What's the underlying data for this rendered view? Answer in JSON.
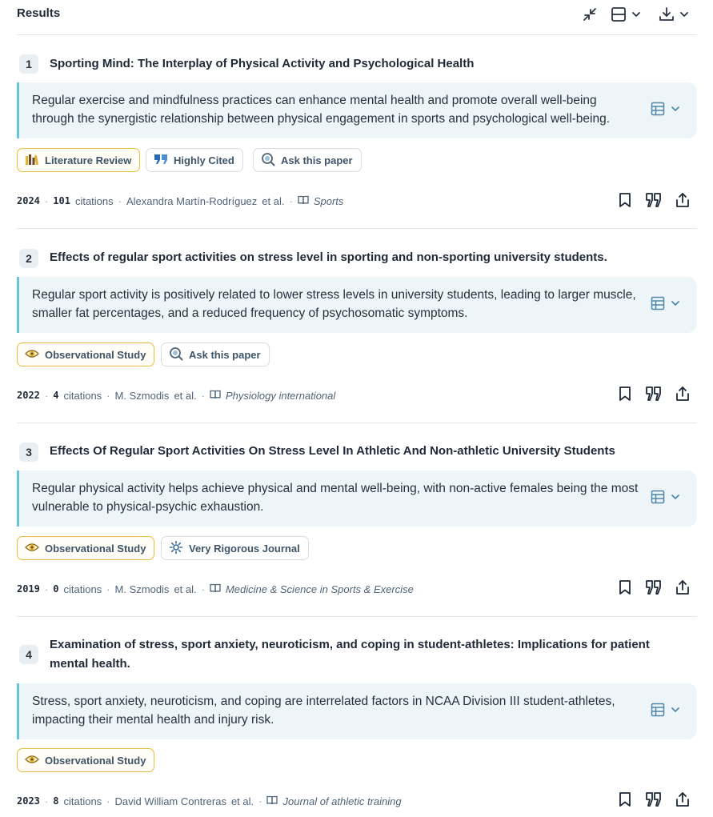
{
  "header": {
    "title": "Results"
  },
  "results": [
    {
      "num": "1",
      "title": "Sporting Mind: The Interplay of Physical Activity and Psychological Health",
      "summary": "Regular exercise and mindfulness practices can enhance mental health and promote overall well-being through the synergistic relationship between physical engagement in sports and psychological well-being.",
      "tags": [
        "Literature Review",
        "Highly Cited",
        "Ask this paper"
      ],
      "year": "2024",
      "citations": "101",
      "citations_label": "citations",
      "author": "Alexandra Martín-Rodríguez",
      "etal": "et al.",
      "journal": "Sports"
    },
    {
      "num": "2",
      "title": "Effects of regular sport activities on stress level in sporting and non-sporting university students.",
      "summary": "Regular sport activity is positively related to lower stress levels in university students, leading to larger muscle, smaller fat percentages, and a reduced frequency of psychosomatic symptoms.",
      "tags": [
        "Observational Study",
        "Ask this paper"
      ],
      "year": "2022",
      "citations": "4",
      "citations_label": "citations",
      "author": "M. Szmodis",
      "etal": "et al.",
      "journal": "Physiology international"
    },
    {
      "num": "3",
      "title": "Effects Of Regular Sport Activities On Stress Level In Athletic And Non-athletic University Students",
      "summary": "Regular physical activity helps achieve physical and mental well-being, with non-active females being the most vulnerable to physical-psychic exhaustion.",
      "tags": [
        "Observational Study",
        "Very Rigorous Journal"
      ],
      "year": "2019",
      "citations": "0",
      "citations_label": "citations",
      "author": "M. Szmodis",
      "etal": "et al.",
      "journal": "Medicine & Science in Sports & Exercise"
    },
    {
      "num": "4",
      "title": "Examination of stress, sport anxiety, neuroticism, and coping in student-athletes: Implications for patient mental health.",
      "summary": "Stress, sport anxiety, neuroticism, and coping are interrelated factors in NCAA Division III student-athletes, impacting their mental health and injury risk.",
      "tags": [
        "Observational Study"
      ],
      "year": "2023",
      "citations": "8",
      "citations_label": "citations",
      "author": "David William Contreras",
      "etal": "et al.",
      "journal": "Journal of athletic training"
    }
  ],
  "colors": {
    "accent_border": "#6cc3dd",
    "summary_bg": "#eef5f9",
    "gold_tag_border": "#e6bd3d"
  },
  "icons": {
    "header": [
      "collapse-icon",
      "layout-icon",
      "download-icon"
    ],
    "row_actions": [
      "bookmark-icon",
      "quote-icon",
      "share-icon"
    ]
  }
}
